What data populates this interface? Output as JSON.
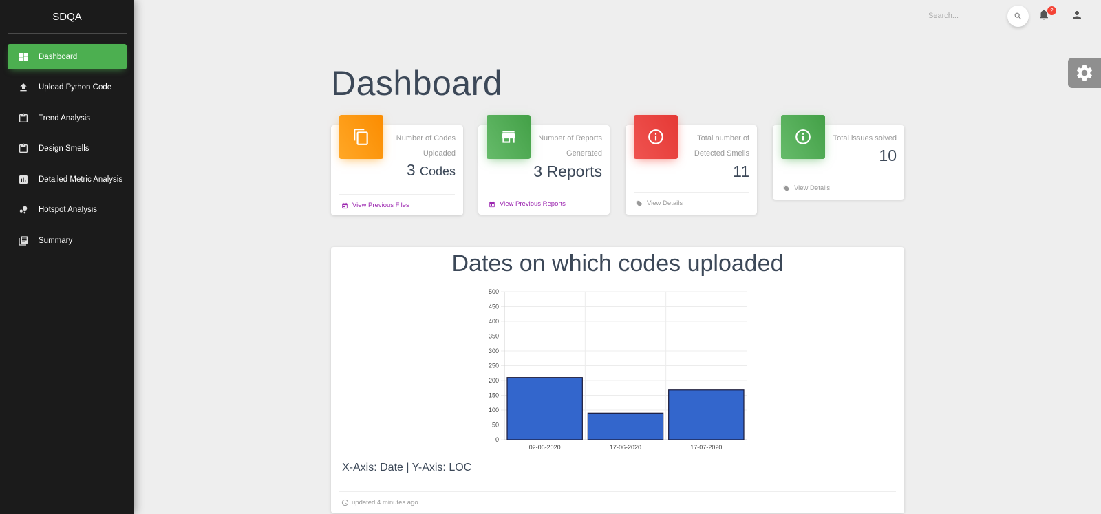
{
  "sidebar": {
    "brand": "SDQA",
    "items": [
      {
        "label": "Dashboard",
        "icon": "dashboard-icon"
      },
      {
        "label": "Upload Python Code",
        "icon": "upload-icon"
      },
      {
        "label": "Trend Analysis",
        "icon": "clipboard-icon"
      },
      {
        "label": "Design Smells",
        "icon": "clipboard-icon"
      },
      {
        "label": "Detailed Metric Analysis",
        "icon": "bar-chart-icon"
      },
      {
        "label": "Hotspot Analysis",
        "icon": "bubble-icon"
      },
      {
        "label": "Summary",
        "icon": "list-icon"
      }
    ]
  },
  "topbar": {
    "search_placeholder": "Search...",
    "notification_count": "2"
  },
  "page": {
    "title": "Dashboard"
  },
  "cards": [
    {
      "category": "Number of Codes Uploaded",
      "value": "3",
      "unit": "Codes",
      "footer": "View Previous Files",
      "color": "#fb8c00",
      "icon": "copy-icon",
      "footer_icon": "calendar-icon"
    },
    {
      "category": "Number of Reports Generated",
      "value": "3 Reports",
      "footer": "View Previous Reports",
      "color": "#43a047",
      "icon": "store-icon",
      "footer_icon": "calendar-icon"
    },
    {
      "category": "Total number of Detected Smells",
      "value": "11",
      "footer": "View Details",
      "color": "#e53935",
      "icon": "info-icon",
      "footer_icon": "tag-icon"
    },
    {
      "category": "Total issues solved",
      "value": "10",
      "footer": "View Details",
      "color": "#43a047",
      "icon": "info-icon",
      "footer_icon": "tag-icon"
    }
  ],
  "chart": {
    "caption": "X-Axis: Date | Y-Axis: LOC",
    "footer": "updated 4 minutes ago"
  },
  "chart_data": {
    "type": "bar",
    "title": "Dates on which codes uploaded",
    "xlabel": "Date",
    "ylabel": "LOC",
    "categories": [
      "02-06-2020",
      "17-06-2020",
      "17-07-2020"
    ],
    "values": [
      210,
      90,
      168
    ],
    "ylim": [
      0,
      500
    ],
    "yticks": [
      0,
      50,
      100,
      150,
      200,
      250,
      300,
      350,
      400,
      450,
      500
    ],
    "bar_color": "#3366cc",
    "grid": true,
    "legend": "none"
  }
}
